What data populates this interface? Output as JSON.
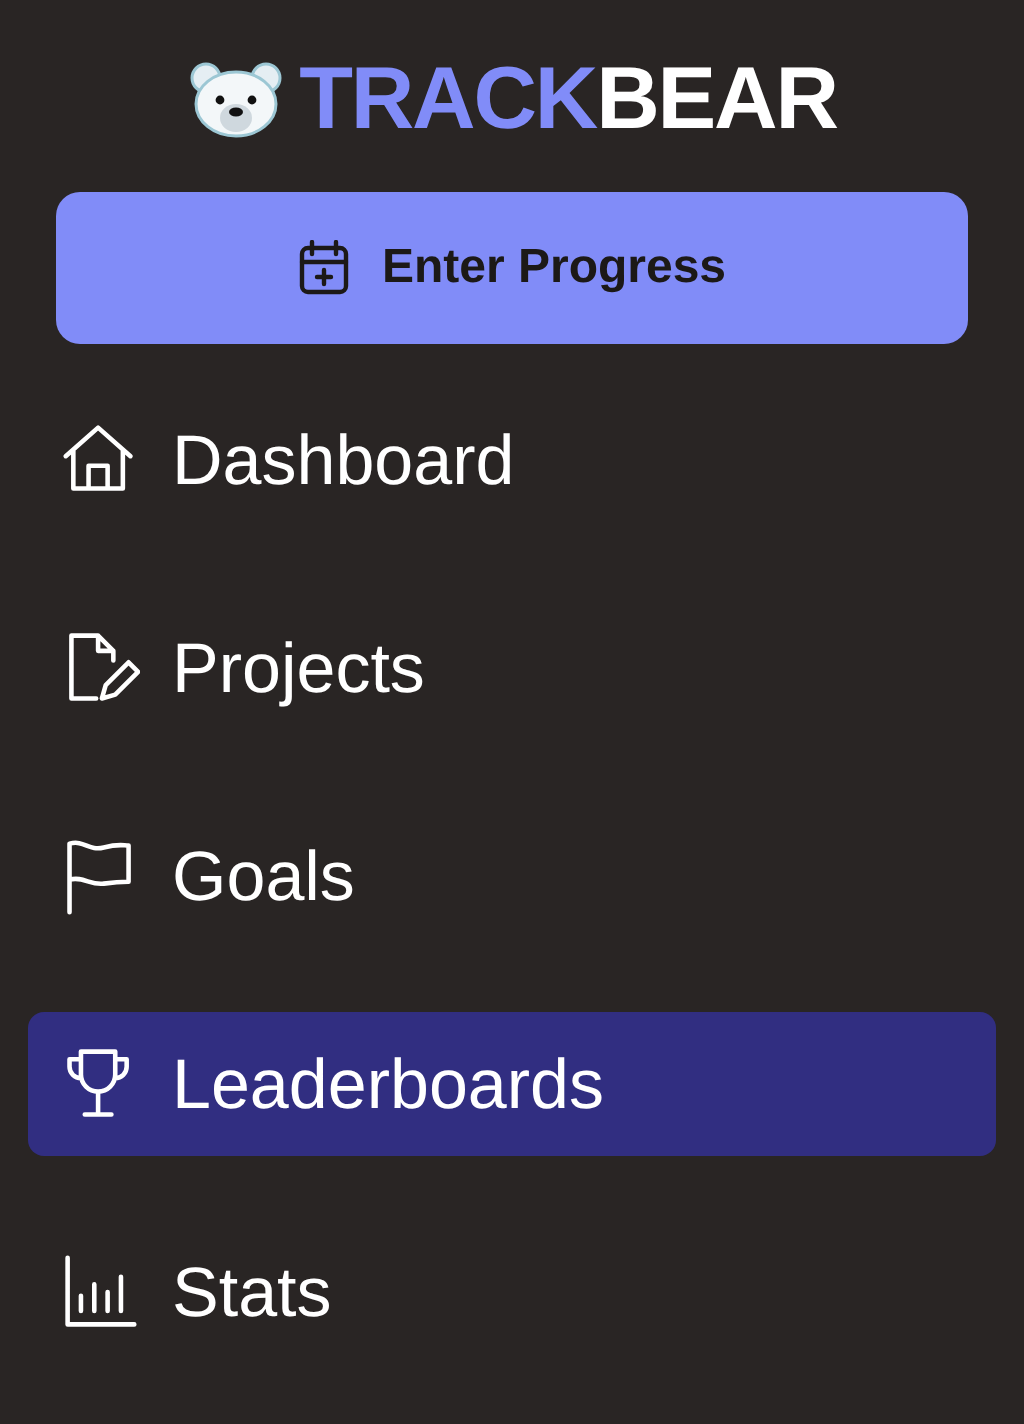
{
  "logo": {
    "accent": "TRACK",
    "text": "BEAR"
  },
  "primary_button": {
    "label": "Enter Progress"
  },
  "nav_items": [
    {
      "label": "Dashboard",
      "selected": false
    },
    {
      "label": "Projects",
      "selected": false
    },
    {
      "label": "Goals",
      "selected": false
    },
    {
      "label": "Leaderboards",
      "selected": true
    },
    {
      "label": "Stats",
      "selected": false
    }
  ]
}
